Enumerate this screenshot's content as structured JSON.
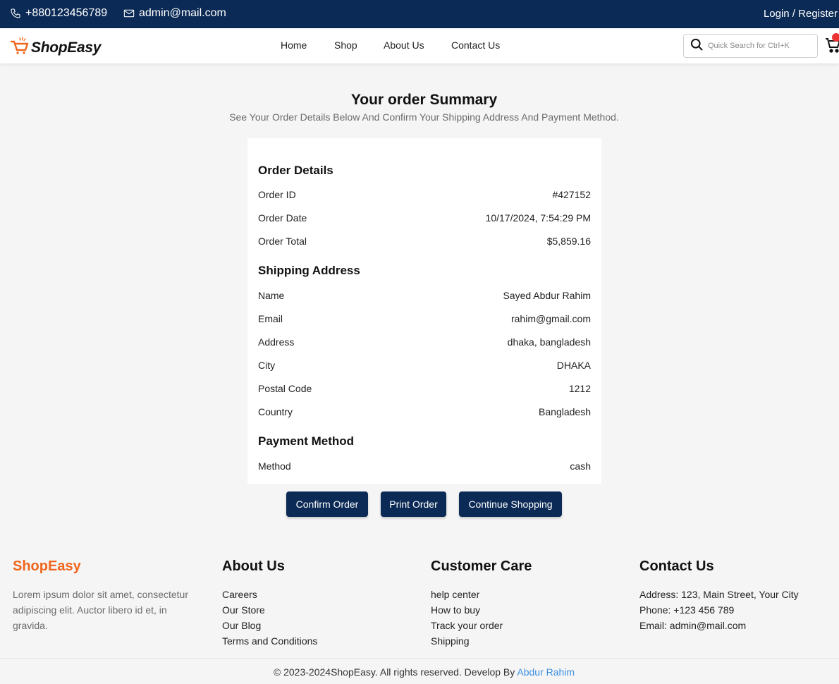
{
  "topbar": {
    "phone": "+880123456789",
    "email": "admin@mail.com",
    "login": "Login / Register"
  },
  "header": {
    "logo_text": "ShopEasy",
    "nav": [
      "Home",
      "Shop",
      "About Us",
      "Contact Us"
    ],
    "search_placeholder": "Quick Search for Ctrl+K",
    "cart_icon": "cart-icon"
  },
  "summary": {
    "title": "Your order Summary",
    "subtitle": "See Your Order Details Below And Confirm Your Shipping Address And Payment Method."
  },
  "order_details": {
    "title": "Order Details",
    "rows": [
      {
        "label": "Order ID",
        "value": "#427152"
      },
      {
        "label": "Order Date",
        "value": "10/17/2024, 7:54:29 PM"
      },
      {
        "label": "Order Total",
        "value": "$5,859.16"
      }
    ]
  },
  "shipping": {
    "title": "Shipping Address",
    "rows": [
      {
        "label": "Name",
        "value": "Sayed Abdur Rahim"
      },
      {
        "label": "Email",
        "value": "rahim@gmail.com"
      },
      {
        "label": "Address",
        "value": "dhaka, bangladesh"
      },
      {
        "label": "City",
        "value": "DHAKA"
      },
      {
        "label": "Postal Code",
        "value": "1212"
      },
      {
        "label": "Country",
        "value": "Bangladesh"
      }
    ]
  },
  "payment": {
    "title": "Payment Method",
    "rows": [
      {
        "label": "Method",
        "value": "cash"
      }
    ]
  },
  "actions": {
    "confirm": "Confirm Order",
    "print": "Print Order",
    "continue": "Continue Shopping"
  },
  "footer": {
    "brand": {
      "title": "ShopEasy",
      "text": "Lorem ipsum dolor sit amet, consectetur adipiscing elit. Auctor libero id et, in gravida."
    },
    "about": {
      "title": "About Us",
      "links": [
        "Careers",
        "Our Store",
        "Our Blog",
        "Terms and Conditions"
      ]
    },
    "care": {
      "title": "Customer Care",
      "links": [
        "help center",
        "How to buy",
        "Track your order",
        "Shipping"
      ]
    },
    "contact": {
      "title": "Contact Us",
      "lines": [
        "Address: 123, Main Street, Your City",
        "Phone: +123 456 789",
        "Email: admin@mail.com"
      ]
    },
    "copyright": "© 2023-2024ShopEasy. All rights reserved. Develop By ",
    "developer": "Abdur Rahim"
  },
  "colors": {
    "primary": "#0b2a55",
    "brand_orange": "#f0661e",
    "link_blue": "#3d8fe0",
    "background": "#f5f5f5"
  }
}
